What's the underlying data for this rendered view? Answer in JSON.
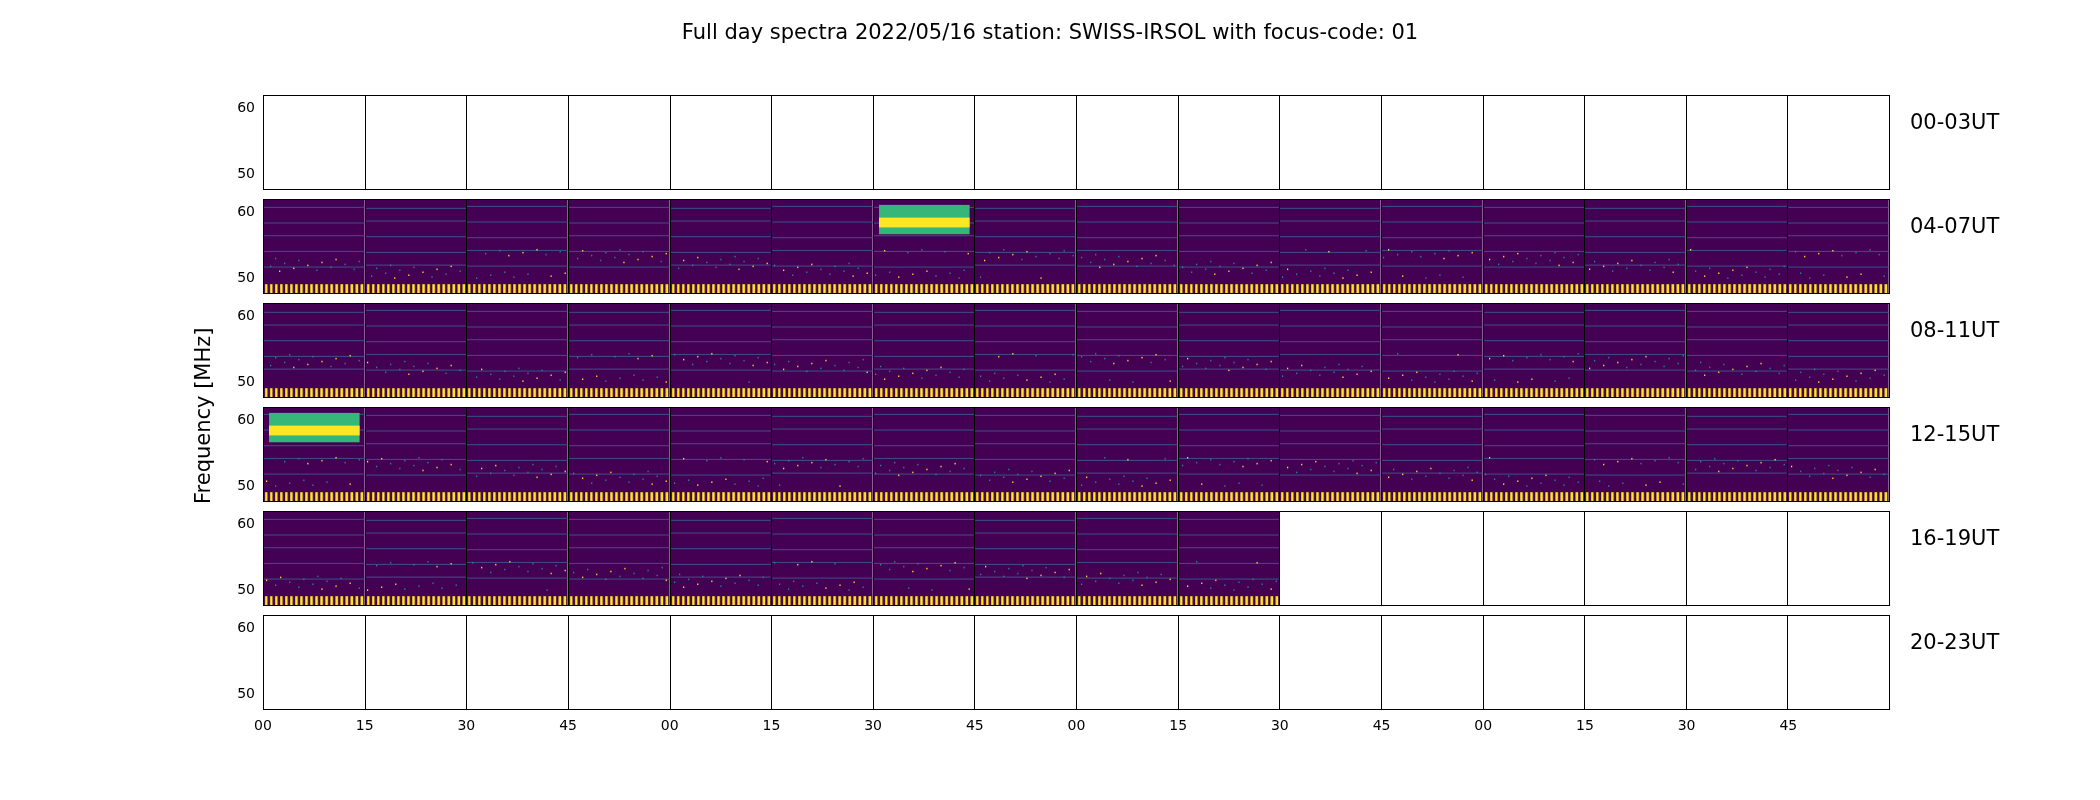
{
  "title": "Full day spectra 2022/05/16 station: SWISS-IRSOL with focus-code: 01",
  "ylabel": "Frequency [MHz]",
  "rows": [
    {
      "label": "00-03UT",
      "yticks": [
        "60",
        "50"
      ],
      "cells": [
        {
          "kind": "empty"
        },
        {
          "kind": "empty"
        },
        {
          "kind": "empty"
        },
        {
          "kind": "empty"
        },
        {
          "kind": "empty"
        },
        {
          "kind": "empty"
        },
        {
          "kind": "empty"
        },
        {
          "kind": "empty"
        },
        {
          "kind": "empty"
        },
        {
          "kind": "empty"
        },
        {
          "kind": "empty"
        },
        {
          "kind": "empty"
        },
        {
          "kind": "empty"
        },
        {
          "kind": "empty"
        },
        {
          "kind": "empty"
        },
        {
          "kind": "empty"
        }
      ]
    },
    {
      "label": "04-07UT",
      "yticks": [
        "60",
        "50"
      ],
      "cells": [
        {
          "kind": "spectrum"
        },
        {
          "kind": "spectrum"
        },
        {
          "kind": "spectrum"
        },
        {
          "kind": "spectrum"
        },
        {
          "kind": "spectrum"
        },
        {
          "kind": "spectrum"
        },
        {
          "kind": "burst"
        },
        {
          "kind": "spectrum"
        },
        {
          "kind": "spectrum"
        },
        {
          "kind": "spectrum"
        },
        {
          "kind": "spectrum"
        },
        {
          "kind": "spectrum"
        },
        {
          "kind": "spectrum"
        },
        {
          "kind": "spectrum"
        },
        {
          "kind": "spectrum"
        },
        {
          "kind": "spectrum"
        }
      ]
    },
    {
      "label": "08-11UT",
      "yticks": [
        "60",
        "50"
      ],
      "cells": [
        {
          "kind": "spectrum"
        },
        {
          "kind": "spectrum"
        },
        {
          "kind": "spectrum"
        },
        {
          "kind": "spectrum"
        },
        {
          "kind": "spectrum"
        },
        {
          "kind": "spectrum"
        },
        {
          "kind": "spectrum"
        },
        {
          "kind": "spectrum"
        },
        {
          "kind": "spectrum"
        },
        {
          "kind": "spectrum"
        },
        {
          "kind": "spectrum"
        },
        {
          "kind": "spectrum"
        },
        {
          "kind": "spectrum"
        },
        {
          "kind": "spectrum"
        },
        {
          "kind": "spectrum"
        },
        {
          "kind": "spectrum"
        }
      ]
    },
    {
      "label": "12-15UT",
      "yticks": [
        "60",
        "50"
      ],
      "cells": [
        {
          "kind": "burst"
        },
        {
          "kind": "spectrum"
        },
        {
          "kind": "spectrum"
        },
        {
          "kind": "spectrum"
        },
        {
          "kind": "spectrum"
        },
        {
          "kind": "spectrum"
        },
        {
          "kind": "spectrum"
        },
        {
          "kind": "spectrum"
        },
        {
          "kind": "spectrum"
        },
        {
          "kind": "spectrum"
        },
        {
          "kind": "spectrum"
        },
        {
          "kind": "spectrum"
        },
        {
          "kind": "spectrum"
        },
        {
          "kind": "spectrum"
        },
        {
          "kind": "spectrum"
        },
        {
          "kind": "spectrum"
        }
      ]
    },
    {
      "label": "16-19UT",
      "yticks": [
        "60",
        "50"
      ],
      "cells": [
        {
          "kind": "spectrum"
        },
        {
          "kind": "spectrum"
        },
        {
          "kind": "spectrum"
        },
        {
          "kind": "spectrum"
        },
        {
          "kind": "spectrum"
        },
        {
          "kind": "spectrum"
        },
        {
          "kind": "spectrum"
        },
        {
          "kind": "spectrum"
        },
        {
          "kind": "spectrum"
        },
        {
          "kind": "spectrum"
        },
        {
          "kind": "empty"
        },
        {
          "kind": "empty"
        },
        {
          "kind": "empty"
        },
        {
          "kind": "empty"
        },
        {
          "kind": "empty"
        },
        {
          "kind": "empty"
        }
      ]
    },
    {
      "label": "20-23UT",
      "yticks": [
        "60",
        "50"
      ],
      "cells": [
        {
          "kind": "empty"
        },
        {
          "kind": "empty"
        },
        {
          "kind": "empty"
        },
        {
          "kind": "empty"
        },
        {
          "kind": "empty"
        },
        {
          "kind": "empty"
        },
        {
          "kind": "empty"
        },
        {
          "kind": "empty"
        },
        {
          "kind": "empty"
        },
        {
          "kind": "empty"
        },
        {
          "kind": "empty"
        },
        {
          "kind": "empty"
        },
        {
          "kind": "empty"
        },
        {
          "kind": "empty"
        },
        {
          "kind": "empty"
        },
        {
          "kind": "empty"
        }
      ]
    }
  ],
  "xticks": [
    "00",
    "15",
    "30",
    "45",
    "00",
    "15",
    "30",
    "45",
    "00",
    "15",
    "30",
    "45",
    "00",
    "15",
    "30",
    "45"
  ]
}
